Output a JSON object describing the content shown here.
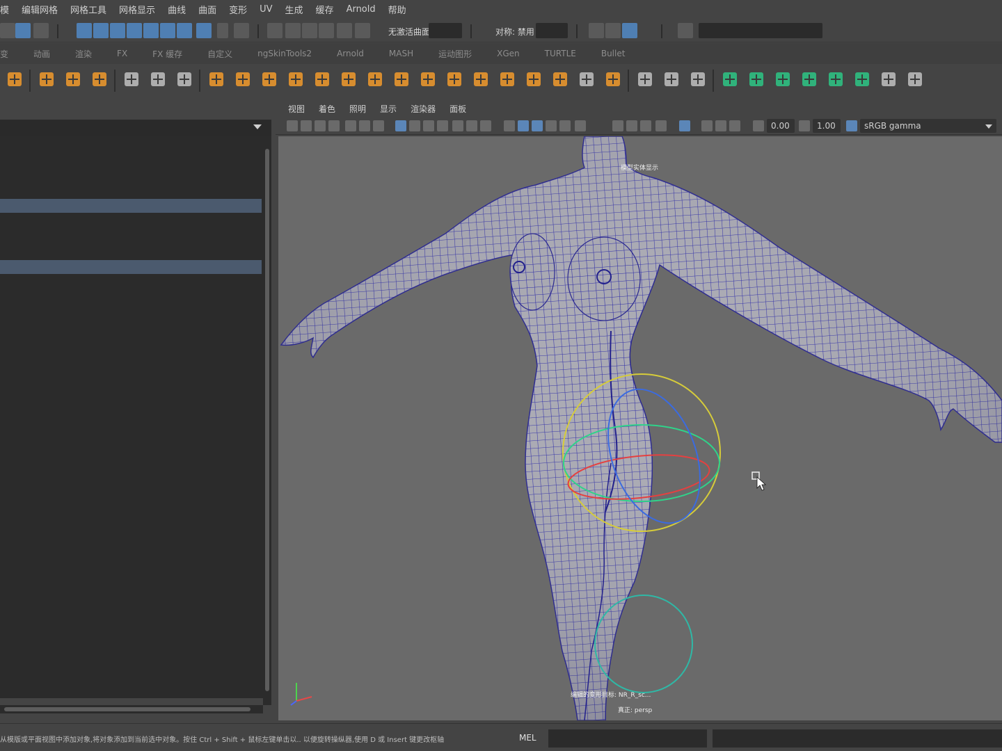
{
  "menubar": {
    "items": [
      "模",
      "编辑网格",
      "网格工具",
      "网格显示",
      "曲线",
      "曲面",
      "变形",
      "UV",
      "生成",
      "缓存",
      "Arnold",
      "帮助"
    ]
  },
  "statusline": {
    "live_surface": "无激活曲面",
    "symmetry": "对称: 禁用"
  },
  "shelf_tabs": [
    "变",
    "动画",
    "渲染",
    "FX",
    "FX 缓存",
    "自定义",
    "ngSkinTools2",
    "Arnold",
    "MASH",
    "运动图形",
    "XGen",
    "TURTLE",
    "Bullet"
  ],
  "shelf_icons": [
    "arnold-icon",
    "star-icon",
    "text-icon",
    "svg-icon",
    "deform-icon",
    "cluster-icon",
    "joint-icon",
    "sphere-icon",
    "cube-stack-icon",
    "uv-icon",
    "grid-icon",
    "grid2-icon",
    "select-icon",
    "select2-icon",
    "cylinder-icon",
    "particle-icon",
    "cube-icon",
    "blocks-icon",
    "soccer-icon",
    "boolean-icon",
    "flat-icon",
    "frame-icon",
    "extrude-icon",
    "knife-icon",
    "bridge-icon",
    "multicut-icon",
    "green-cube-icon",
    "green-cube2-icon",
    "green-cube3-icon",
    "green-cube4-icon",
    "green-arrow-icon",
    "checker-icon",
    "crossed-tools-icon",
    "x-tool-icon"
  ],
  "viewport": {
    "menu": [
      "视图",
      "着色",
      "照明",
      "显示",
      "渲染器",
      "面板"
    ],
    "exposure": "0.00",
    "gamma": "1.00",
    "color_space": "sRGB gamma",
    "hud_top": "模型实体显示",
    "hud_bottom": "编辑的变形目标: NR_R_sc...",
    "camera_label": "真正: persp"
  },
  "helpline": {
    "text": "从模版或平面视图中添加对象,将对象添加到当前选中对象。按住 Ctrl + Shift + 鼠标左键单击以.. 以便旋转操纵器,使用 D 或 Insert 键更改枢轴",
    "mel": "MEL"
  }
}
